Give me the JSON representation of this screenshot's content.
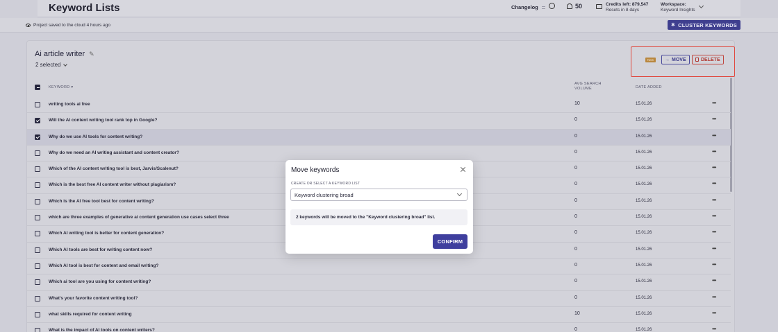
{
  "header": {
    "title": "Keyword Lists",
    "changelog": "Changelog",
    "notifications_count": "50",
    "credits_line1": "Credits left: 879,547",
    "credits_line2": "Resets in 8 days",
    "workspace_label": "Workspace:",
    "workspace_name": "Keyword Insights"
  },
  "subbar": {
    "saved_status": "Project saved to the cloud 4 hours ago",
    "cluster_button": "CLUSTER KEYWORDS"
  },
  "list": {
    "title": "Ai article writer",
    "selected": "2 selected",
    "new_badge": "New",
    "move_button": "MOVE",
    "delete_button": "DELETE"
  },
  "table": {
    "columns": {
      "keyword": "KEYWORD",
      "volume_line1": "AVG SEARCH",
      "volume_line2": "VOLUME",
      "date": "DATE ADDED"
    },
    "rows": [
      {
        "keyword": "writing tools ai free",
        "volume": "10",
        "date": "15.01.26",
        "checked": false
      },
      {
        "keyword": "Will the AI content writing tool rank top in Google?",
        "volume": "0",
        "date": "15.01.26",
        "checked": true
      },
      {
        "keyword": "Why do we use AI tools for content writing?",
        "volume": "0",
        "date": "15.01.26",
        "checked": true
      },
      {
        "keyword": "Why do we need an AI writing assistant and content creator?",
        "volume": "0",
        "date": "15.01.26",
        "checked": false
      },
      {
        "keyword": "Which of the AI content writing tool is best, Jarvis/Scalenut?",
        "volume": "0",
        "date": "15.01.26",
        "checked": false
      },
      {
        "keyword": "Which is the best free AI content writer without plagiarism?",
        "volume": "0",
        "date": "15.01.26",
        "checked": false
      },
      {
        "keyword": "Which is the AI free tool best for content writing?",
        "volume": "0",
        "date": "15.01.26",
        "checked": false
      },
      {
        "keyword": "which are three examples of generative ai content generation use cases select three",
        "volume": "0",
        "date": "15.01.26",
        "checked": false
      },
      {
        "keyword": "Which AI writing tool is better for content generation?",
        "volume": "0",
        "date": "15.01.26",
        "checked": false
      },
      {
        "keyword": "Which AI tools are best for writing content now?",
        "volume": "0",
        "date": "15.01.26",
        "checked": false
      },
      {
        "keyword": "Which AI tool is best for content and email writing?",
        "volume": "0",
        "date": "15.01.26",
        "checked": false
      },
      {
        "keyword": "Which ai tool are you using for content writing?",
        "volume": "0",
        "date": "15.01.26",
        "checked": false
      },
      {
        "keyword": "What's your favorite content writing tool?",
        "volume": "0",
        "date": "15.01.26",
        "checked": false
      },
      {
        "keyword": "what skills required for content writing",
        "volume": "10",
        "date": "15.01.26",
        "checked": false
      },
      {
        "keyword": "What is the impact of AI tools on content writers?",
        "volume": "0",
        "date": "15.01.26",
        "checked": false
      }
    ]
  },
  "modal": {
    "title": "Move keywords",
    "field_label": "CREATE OR SELECT A KEYWORD LIST",
    "selected_list": "Keyword clustering broad",
    "note": "2 keywords will be moved to the \"Keyword clustering broad\" list.",
    "confirm_button": "CONFIRM"
  },
  "colors": {
    "accent": "#3f3f9e",
    "danger": "#c0463e",
    "badge": "#b9873f",
    "highlight_box": "#e0473d"
  }
}
